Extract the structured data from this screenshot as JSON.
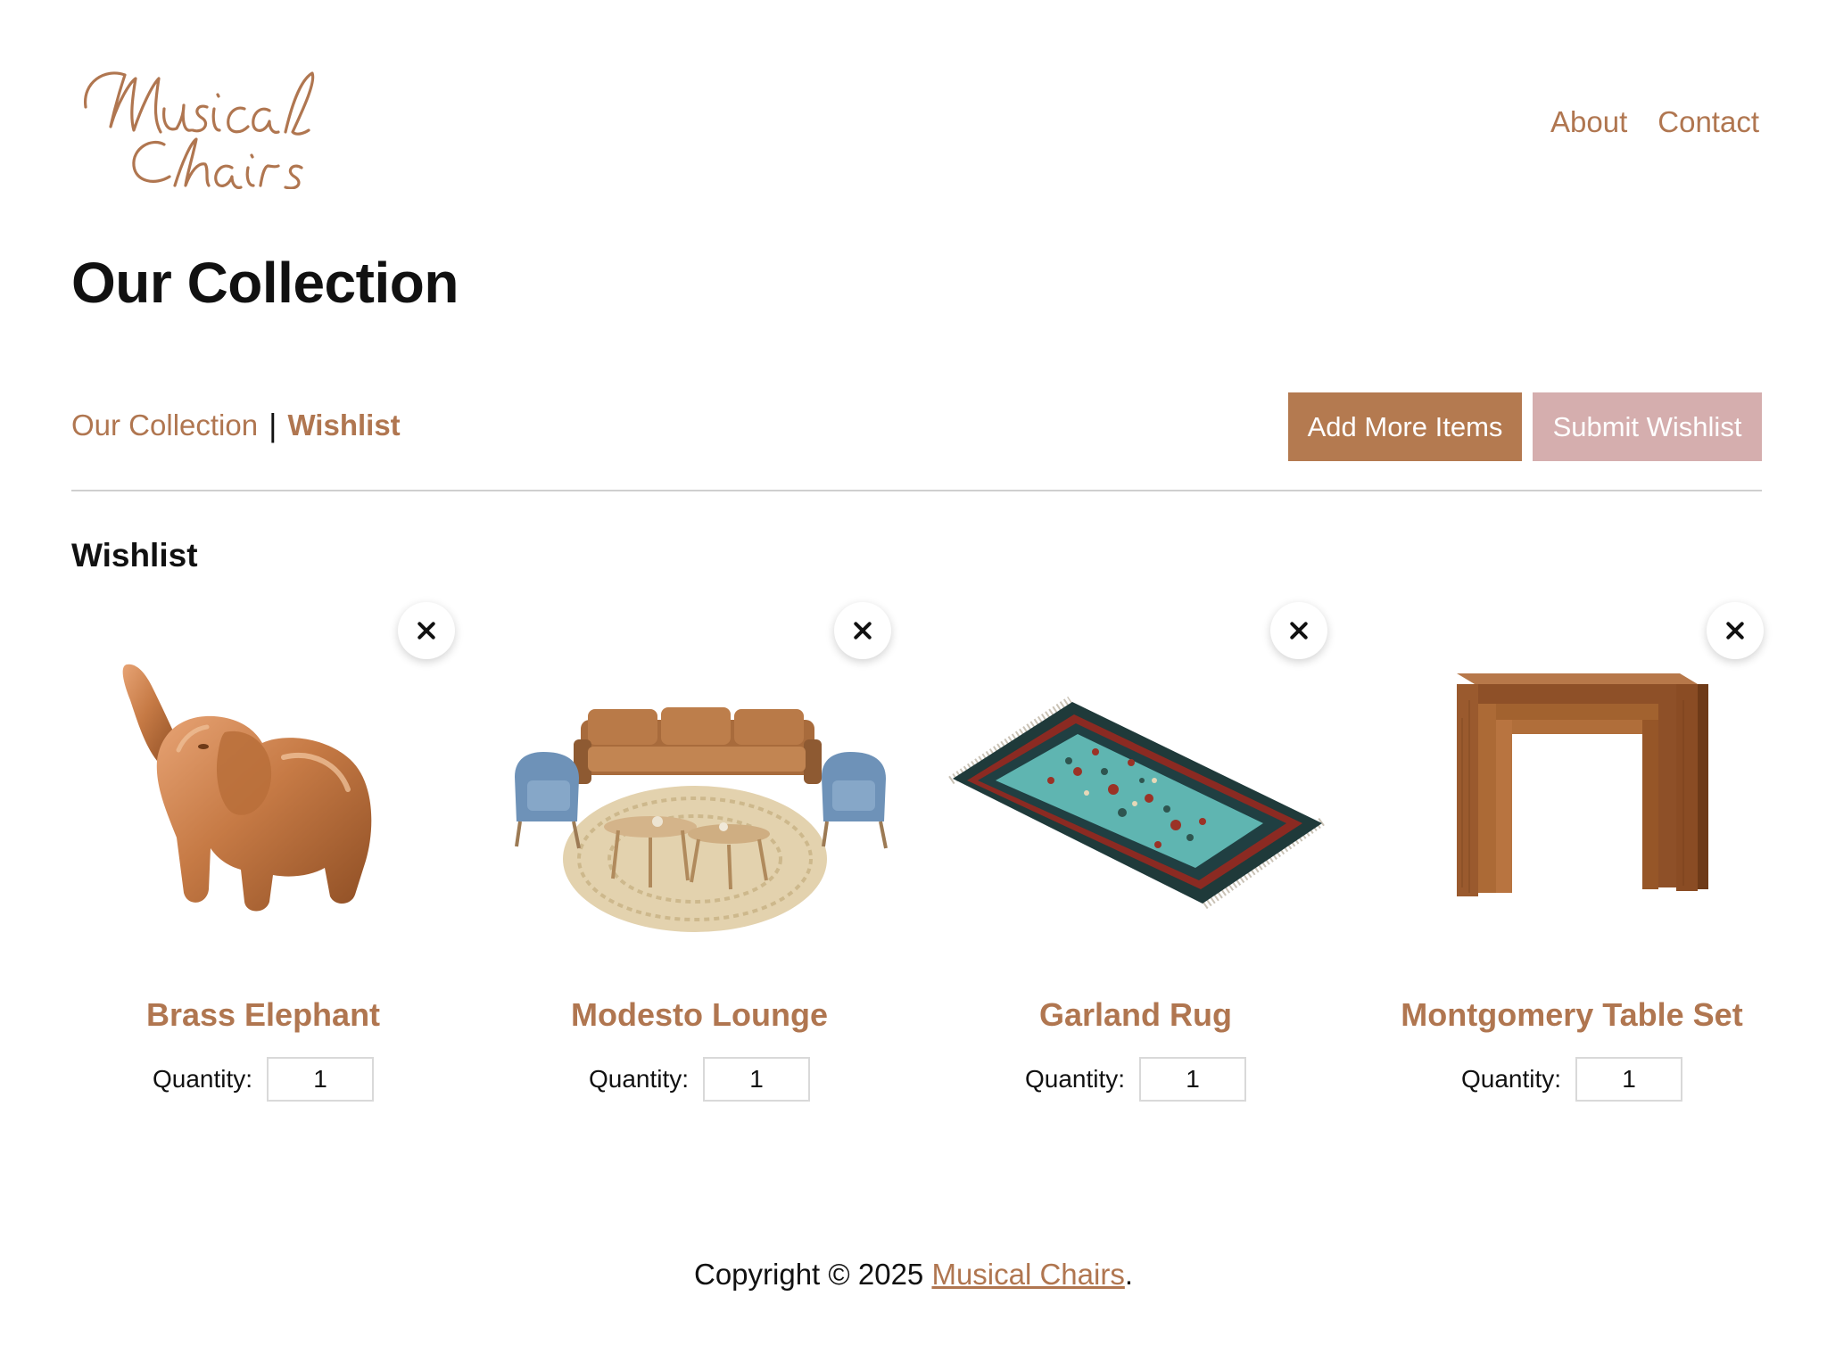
{
  "brand": {
    "logo_text": "Musical Chairs",
    "accent": "#B07650",
    "submit_color": "#D5AEAE"
  },
  "nav": {
    "items": [
      {
        "label": "About"
      },
      {
        "label": "Contact"
      }
    ]
  },
  "page": {
    "title": "Our Collection"
  },
  "subnav": {
    "collection_label": "Our Collection",
    "separator": "|",
    "wishlist_label": "Wishlist"
  },
  "actions": {
    "add_label": "Add More Items",
    "submit_label": "Submit Wishlist"
  },
  "wishlist": {
    "title": "Wishlist",
    "items": [
      {
        "name": "Brass Elephant",
        "quantity_label": "Quantity:",
        "quantity": "1",
        "image": "brass-elephant-image"
      },
      {
        "name": "Modesto Lounge",
        "quantity_label": "Quantity:",
        "quantity": "1",
        "image": "lounge-set-image"
      },
      {
        "name": "Garland Rug",
        "quantity_label": "Quantity:",
        "quantity": "1",
        "image": "rug-image"
      },
      {
        "name": "Montgomery Table Set",
        "quantity_label": "Quantity:",
        "quantity": "1",
        "image": "nesting-tables-image"
      }
    ]
  },
  "footer": {
    "prefix": "Copyright © 2025 ",
    "link_label": "Musical Chairs",
    "suffix": "."
  }
}
